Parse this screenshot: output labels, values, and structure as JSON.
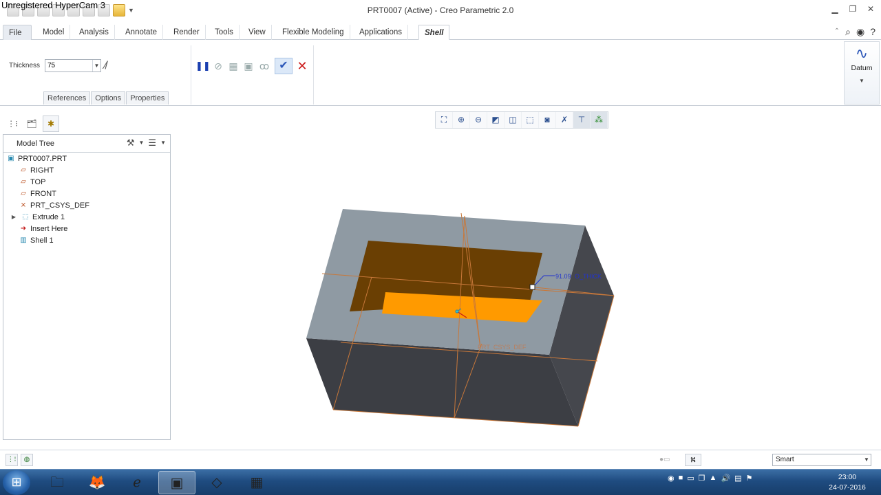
{
  "watermark": "Unregistered HyperCam 3",
  "window": {
    "title": "PRT0007 (Active) - Creo Parametric 2.0"
  },
  "tabs": [
    {
      "label": "File ▾"
    },
    {
      "label": "Model"
    },
    {
      "label": "Analysis"
    },
    {
      "label": "Annotate"
    },
    {
      "label": "Render"
    },
    {
      "label": "Tools"
    },
    {
      "label": "View"
    },
    {
      "label": "Flexible Modeling"
    },
    {
      "label": "Applications"
    },
    {
      "label": "Shell"
    }
  ],
  "ribbon": {
    "thickness_label": "Thickness",
    "thickness_value": "75",
    "subtabs": [
      "References",
      "Options",
      "Properties"
    ],
    "datum_label": "Datum"
  },
  "model_tree": {
    "title": "Model Tree",
    "items": [
      {
        "label": "PRT0007.PRT",
        "icon": "part-icon"
      },
      {
        "label": "RIGHT",
        "icon": "datum-plane-icon"
      },
      {
        "label": "TOP",
        "icon": "datum-plane-icon"
      },
      {
        "label": "FRONT",
        "icon": "datum-plane-icon"
      },
      {
        "label": "PRT_CSYS_DEF",
        "icon": "csys-icon"
      },
      {
        "label": "Extrude 1",
        "icon": "extrude-icon"
      },
      {
        "label": "Insert Here",
        "icon": "insert-arrow-icon"
      },
      {
        "label": "Shell 1",
        "icon": "shell-icon"
      }
    ]
  },
  "viewport": {
    "dimension_label": "91.09",
    "dimension_name": "O_THICK",
    "csys_label": "PRT_CSYS_DEF"
  },
  "statusbar": {
    "filter": "Smart"
  },
  "taskbar": {
    "time": "23:00",
    "date": "24-07-2016"
  },
  "colors": {
    "part_top": "#8f9aa3",
    "part_front": "#3c3e44",
    "part_side": "#45474d",
    "pocket_back": "#6a3f03",
    "pocket_floor": "#ff9a00",
    "datum_line": "#c8783a",
    "dimension_blue": "#2233cc"
  }
}
